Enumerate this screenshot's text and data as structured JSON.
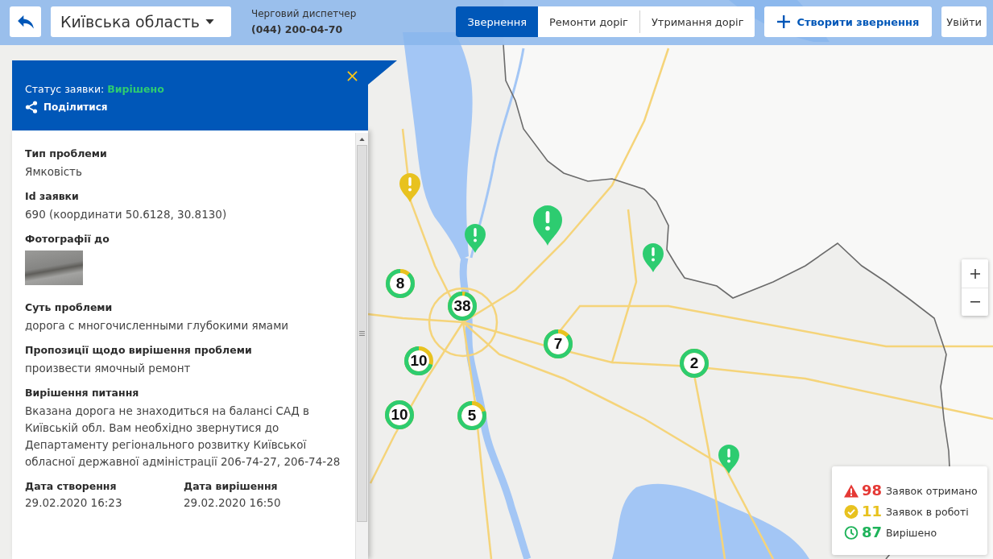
{
  "top_bar": {
    "region_select": {
      "value": "Київська область"
    },
    "dispatcher": {
      "label": "Черговий диспетчер",
      "phone": "(044) 200-04-70"
    },
    "tabs": [
      {
        "label": "Звернення",
        "selected": true
      },
      {
        "label": "Ремонти доріг",
        "selected": false
      },
      {
        "label": "Утримання доріг",
        "selected": false
      }
    ],
    "create_button": {
      "label": "Створити звернення"
    },
    "login_button": {
      "label": "Увійти"
    }
  },
  "request_panel": {
    "status_label": "Статус заявки:",
    "status": "Вирішено",
    "share_label": "Поділитися",
    "fields": [
      {
        "kind": "text",
        "label": "Тип проблеми",
        "value": "Ямковість"
      },
      {
        "kind": "text",
        "label": "Id заявки",
        "value": "690 (координати 50.6128, 30.8130)"
      },
      {
        "kind": "photo",
        "label": "Фотографії до"
      },
      {
        "kind": "text",
        "label": "Суть проблеми",
        "value": "дорога с многочисленными глубокими ямами"
      },
      {
        "kind": "text",
        "label": "Пропозиції щодо вирішення проблеми",
        "value": "произвести ямочный ремонт"
      },
      {
        "kind": "text",
        "label": "Вирішення питання",
        "value": "Вказана дорога не знаходиться на балансі САД в Київській обл. Вам необхідно звернутися до Департаменту регіонального розвитку Київської обласної державної адміністрації 206-74-27, 206-74-28"
      }
    ],
    "dates": [
      {
        "label": "Дата створення",
        "value": "29.02.2020 16:23"
      },
      {
        "label": "Дата вирішення",
        "value": "29.02.2020 16:50"
      }
    ]
  },
  "map": {
    "markers": [
      {
        "kind": "pin",
        "color": "#e8c21f"
      },
      {
        "kind": "pin",
        "color": "#2dcc70"
      },
      {
        "kind": "pin",
        "color": "#2dcc70"
      },
      {
        "kind": "pin",
        "color": "#2dcc70"
      },
      {
        "kind": "cluster",
        "count": "8",
        "level": 0.88
      },
      {
        "kind": "cluster",
        "count": "38",
        "level": 0.96
      },
      {
        "kind": "cluster",
        "count": "7",
        "level": 0.86
      },
      {
        "kind": "cluster",
        "count": "10",
        "level": 0.7
      },
      {
        "kind": "cluster",
        "count": "2",
        "level": 1
      },
      {
        "kind": "cluster",
        "count": "10",
        "level": 1
      },
      {
        "kind": "cluster",
        "count": "5",
        "level": 0.8
      },
      {
        "kind": "pin",
        "color": "#2dcc70"
      }
    ]
  },
  "legend": {
    "items": [
      {
        "kind": "received",
        "count": "98",
        "label": "Заявок отримано",
        "color": "#e53935"
      },
      {
        "kind": "in_progress",
        "count": "11",
        "label": "Заявок в роботі",
        "color": "#e8c21f"
      },
      {
        "kind": "resolved",
        "count": "87",
        "label": "Вирішено",
        "color": "#1fb35a"
      }
    ]
  }
}
